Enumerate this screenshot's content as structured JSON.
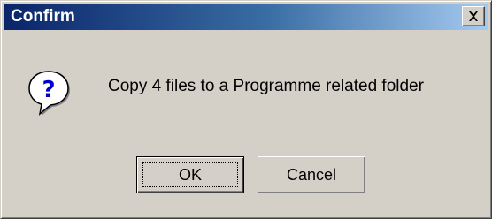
{
  "dialog": {
    "title": "Confirm",
    "message": "Copy 4 files to a Programme related folder",
    "icon": "question-icon",
    "buttons": {
      "ok_label": "OK",
      "cancel_label": "Cancel"
    },
    "colors": {
      "titlebar_start": "#0a246a",
      "titlebar_end": "#a6caf0",
      "face": "#d4d0c8",
      "icon_bubble": "#ffffff",
      "icon_glyph": "#0000cc"
    }
  }
}
